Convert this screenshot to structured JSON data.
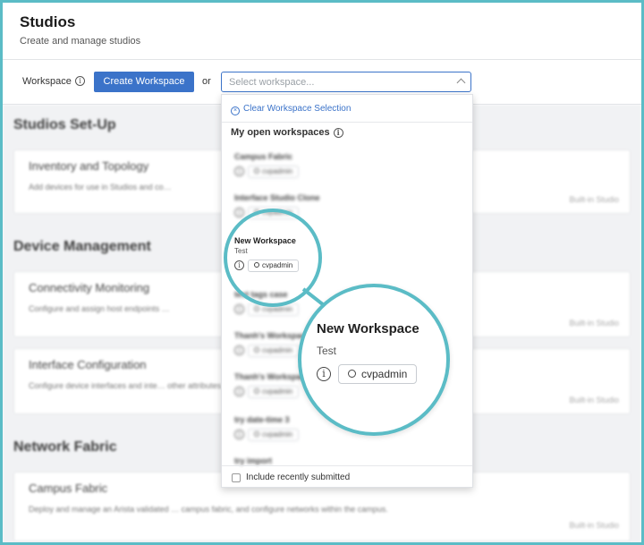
{
  "page": {
    "title": "Studios",
    "subtitle": "Create and manage studios"
  },
  "toolbar": {
    "workspace_label": "Workspace",
    "create_button": "Create Workspace",
    "or_label": "or",
    "select_placeholder": "Select workspace..."
  },
  "background": {
    "sections": [
      {
        "heading": "Studios Set-Up",
        "cards": [
          {
            "title": "Inventory and Topology",
            "description": "Add devices for use in Studios and co…",
            "badge": "Built-in Studio"
          }
        ]
      },
      {
        "heading": "Device Management",
        "cards": [
          {
            "title": "Connectivity Monitoring",
            "description": "Configure and assign host endpoints …",
            "badge": "Built-in Studio"
          },
          {
            "title": "Interface Configuration",
            "description": "Configure device interfaces and inte… other attributes.",
            "badge": "Built-in Studio"
          }
        ]
      },
      {
        "heading": "Network Fabric",
        "cards": [
          {
            "title": "Campus Fabric",
            "description": "Deploy and manage an Arista validated … campus fabric, and configure networks within the campus.",
            "badge": "Built-in Studio"
          }
        ]
      }
    ]
  },
  "dropdown": {
    "clear_label": "Clear Workspace Selection",
    "heading": "My open workspaces",
    "items": [
      {
        "name": "Campus Fabric",
        "description": "",
        "owner": "cvpadmin"
      },
      {
        "name": "Interface Studio Clone",
        "description": "",
        "owner": "cvpadmin"
      },
      {
        "name": "New Workspace",
        "description": "Test",
        "owner": "cvpadmin"
      },
      {
        "name": "test tags case",
        "description": "",
        "owner": "cvpadmin"
      },
      {
        "name": "Thanh's Workspace",
        "description": "",
        "owner": "cvpadmin"
      },
      {
        "name": "Thanh's Workspace",
        "description": "",
        "owner": "cvpadmin"
      },
      {
        "name": "try date-time 3",
        "description": "",
        "owner": "cvpadmin"
      },
      {
        "name": "try import",
        "description": "",
        "owner": ""
      }
    ],
    "footer_checkbox": "Include recently submitted"
  },
  "magnifier": {
    "name": "New Workspace",
    "description": "Test",
    "owner": "cvpadmin"
  },
  "colors": {
    "accent": "#3b73c9",
    "highlight": "#5bbcc6"
  },
  "icons": [
    "info-icon",
    "clear-circle-icon",
    "chevron-up-icon",
    "user-icon"
  ]
}
